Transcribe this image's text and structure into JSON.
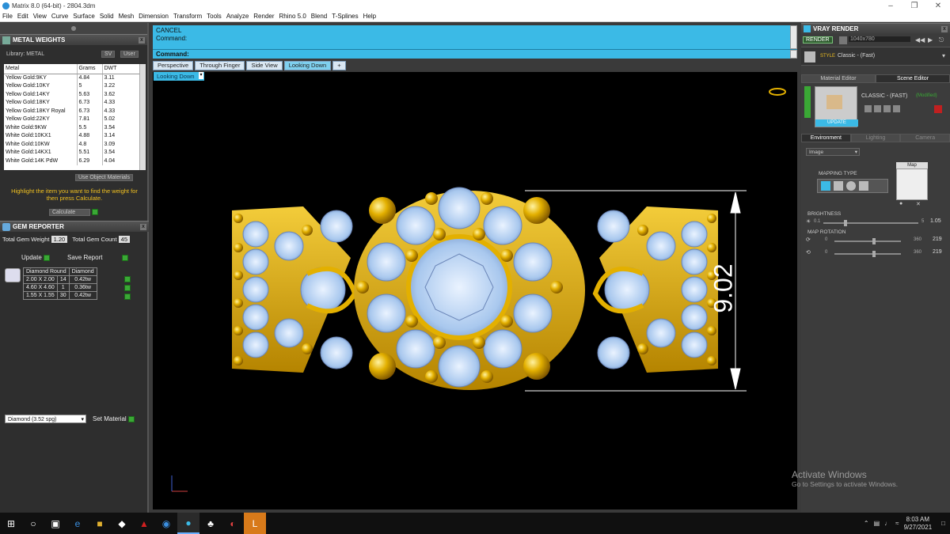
{
  "window": {
    "title": "Matrix 8.0 (64-bit) - 2804.3dm"
  },
  "menu": [
    "File",
    "Edit",
    "View",
    "Curve",
    "Surface",
    "Solid",
    "Mesh",
    "Dimension",
    "Transform",
    "Tools",
    "Analyze",
    "Render",
    "Rhino 5.0",
    "Blend",
    "T-Splines",
    "Help"
  ],
  "metal_weights": {
    "title": "METAL WEIGHTS",
    "library_label": "Library: METAL",
    "sv_label": "SV",
    "user_label": "User",
    "columns": [
      "Metal",
      "Grams",
      "DWT"
    ],
    "rows": [
      {
        "metal": "Yellow Gold:9KY",
        "grams": "4.84",
        "dwt": "3.11"
      },
      {
        "metal": "Yellow Gold:10KY",
        "grams": "5",
        "dwt": "3.22"
      },
      {
        "metal": "Yellow Gold:14KY",
        "grams": "5.63",
        "dwt": "3.62"
      },
      {
        "metal": "Yellow Gold:18KY",
        "grams": "6.73",
        "dwt": "4.33"
      },
      {
        "metal": "Yellow Gold:18KY Royal",
        "grams": "6.73",
        "dwt": "4.33"
      },
      {
        "metal": "Yellow Gold:22KY",
        "grams": "7.81",
        "dwt": "5.02"
      },
      {
        "metal": "White Gold:9KW",
        "grams": "5.5",
        "dwt": "3.54"
      },
      {
        "metal": "White Gold:10KX1",
        "grams": "4.88",
        "dwt": "3.14"
      },
      {
        "metal": "White Gold:10KW",
        "grams": "4.8",
        "dwt": "3.09"
      },
      {
        "metal": "White Gold:14KX1",
        "grams": "5.51",
        "dwt": "3.54"
      },
      {
        "metal": "White Gold:14K PdW",
        "grams": "6.29",
        "dwt": "4.04"
      }
    ],
    "use_object_materials": "Use Object Materials",
    "hint": "Highlight the item you want to find the weight for then press Calculate.",
    "calculate_label": "Calculate"
  },
  "gem_reporter": {
    "title": "GEM REPORTER",
    "total_weight_label": "Total Gem Weight",
    "total_weight_value": "1.20",
    "total_count_label": "Total Gem Count",
    "total_count_value": "45",
    "update_label": "Update",
    "save_report_label": "Save Report",
    "header": [
      "Diamond Round",
      "Diamond"
    ],
    "rows": [
      {
        "size": "2.00 X 2.00",
        "count": "14",
        "weight": "0.42tw"
      },
      {
        "size": "4.60 X 4.60",
        "count": "1",
        "weight": "0.36tw"
      },
      {
        "size": "1.55 X 1.55",
        "count": "30",
        "weight": "0.42tw"
      }
    ],
    "material_select": "Diamond     (3.52 spg)",
    "set_material_label": "Set Material"
  },
  "command": {
    "history": [
      "CANCEL",
      "Command:"
    ],
    "prompt": "Command:"
  },
  "viewport": {
    "tabs": [
      {
        "label": "Perspective",
        "active": false
      },
      {
        "label": "Through Finger",
        "active": false
      },
      {
        "label": "Side View",
        "active": false
      },
      {
        "label": "Looking Down",
        "active": true
      }
    ],
    "add_tab": "+",
    "view_label": "Looking Down",
    "dimension_value": "9.02"
  },
  "vray": {
    "title": "VRAY RENDER",
    "render_label": "RENDER",
    "resolution": "1040x780",
    "style_label": "STYLE",
    "style_value": "Classic - (Fast)",
    "tabs": [
      "Material Editor",
      "Scene Editor"
    ],
    "preset_name": "CLASSIC - (FAST)",
    "preset_state": "(Modified)",
    "update_label": "UPDATE",
    "sub_tabs": [
      "Environment",
      "Lighting",
      "Camera"
    ],
    "env_select": "Image",
    "mapping_type_label": "MAPPING TYPE",
    "map_label": "Map",
    "brightness_label": "BRIGHTNESS",
    "brightness_min": "0.1",
    "brightness_max": "5",
    "brightness_value": "1.05",
    "map_rotation_label": "MAP ROTATION",
    "rot1_min": "0",
    "rot1_max": "360",
    "rot1_value": "219",
    "rot2_min": "0",
    "rot2_max": "360",
    "rot2_value": "219"
  },
  "watermark": {
    "line1": "Activate Windows",
    "line2": "Go to Settings to activate Windows."
  },
  "taskbar": {
    "time": "8:03 AM",
    "date": "9/27/2021"
  },
  "colors": {
    "accent": "#3bbae6",
    "gold": "#e3b000",
    "diamond": "#a9c8ee",
    "go_button": "#3aa835"
  }
}
